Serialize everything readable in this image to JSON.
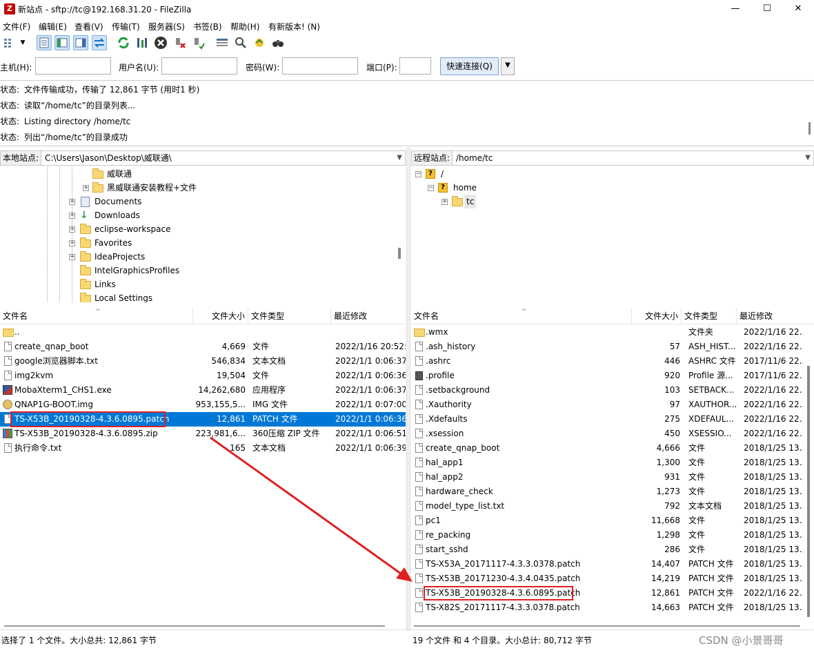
{
  "window": {
    "app_icon": "Z",
    "title": "新站点 - sftp://tc@192.168.31.20 - FileZilla",
    "minimize": "—",
    "maximize": "☐",
    "close": "✕"
  },
  "menu": [
    "文件(F)",
    "编辑(E)",
    "查看(V)",
    "传输(T)",
    "服务器(S)",
    "书签(B)",
    "帮助(H)",
    "有新版本! (N)"
  ],
  "quickconnect": {
    "host_label": "主机(H):",
    "user_label": "用户名(U):",
    "pass_label": "密码(W):",
    "port_label": "端口(P):",
    "host_value": "",
    "user_value": "",
    "pass_value": "",
    "port_value": "",
    "button": "快速连接(Q)"
  },
  "log": [
    {
      "label": "状态:",
      "text": "文件传输成功，传输了 12,861 字节 (用时1 秒)"
    },
    {
      "label": "状态:",
      "text": "读取“/home/tc”的目录列表..."
    },
    {
      "label": "状态:",
      "text": "Listing directory /home/tc"
    },
    {
      "label": "状态:",
      "text": "列出“/home/tc”的目录成功"
    }
  ],
  "local": {
    "site_label": "本地站点:",
    "path": "C:\\Users\\Jason\\Desktop\\威联通\\",
    "tree": [
      "威联通",
      "黑威联通安装教程+文件",
      "Documents",
      "Downloads",
      "eclipse-workspace",
      "Favorites",
      "IdeaProjects",
      "IntelGraphicsProfiles",
      "Links",
      "Local Settings"
    ],
    "columns": [
      "文件名",
      "文件大小",
      "文件类型",
      "最近修改"
    ],
    "files": [
      {
        "name": "..",
        "size": "",
        "type": "",
        "modified": ""
      },
      {
        "name": "create_qnap_boot",
        "size": "4,669",
        "type": "文件",
        "modified": "2022/1/16 20:52:."
      },
      {
        "name": "google浏览器脚本.txt",
        "size": "546,834",
        "type": "文本文档",
        "modified": "2022/1/1 0:06:37"
      },
      {
        "name": "img2kvm",
        "size": "19,504",
        "type": "文件",
        "modified": "2022/1/1 0:06:36"
      },
      {
        "name": "MobaXterm1_CHS1.exe",
        "size": "14,262,680",
        "type": "应用程序",
        "modified": "2022/1/1 0:06:37"
      },
      {
        "name": "QNAP1G-BOOT.img",
        "size": "953,155,5...",
        "type": "IMG 文件",
        "modified": "2022/1/1 0:07:00"
      },
      {
        "name": "TS-X53B_20190328-4.3.6.0895.patch",
        "size": "12,861",
        "type": "PATCH 文件",
        "modified": "2022/1/1 0:06:36"
      },
      {
        "name": "TS-X53B_20190328-4.3.6.0895.zip",
        "size": "223,981,6...",
        "type": "360压缩 ZIP 文件",
        "modified": "2022/1/1 0:06:51"
      },
      {
        "name": "执行命令.txt",
        "size": "165",
        "type": "文本文档",
        "modified": "2022/1/1 0:06:39"
      }
    ],
    "status": "选择了 1 个文件。大小总共: 12,861 字节"
  },
  "remote": {
    "site_label": "远程站点:",
    "path": "/home/tc",
    "tree": [
      "/",
      "home",
      "tc"
    ],
    "columns": [
      "文件名",
      "文件大小",
      "文件类型",
      "最近修改"
    ],
    "files": [
      {
        "name": ".wmx",
        "size": "",
        "type": "文件夹",
        "modified": "2022/1/16 22.."
      },
      {
        "name": ".ash_history",
        "size": "57",
        "type": "ASH_HIST...",
        "modified": "2022/1/16 22.."
      },
      {
        "name": ".ashrc",
        "size": "446",
        "type": "ASHRC 文件",
        "modified": "2017/11/6 22.."
      },
      {
        "name": ".profile",
        "size": "920",
        "type": "Profile 源...",
        "modified": "2017/11/6 22.."
      },
      {
        "name": ".setbackground",
        "size": "103",
        "type": "SETBACK...",
        "modified": "2022/1/16 22.."
      },
      {
        "name": ".Xauthority",
        "size": "97",
        "type": "XAUTHOR...",
        "modified": "2022/1/16 22.."
      },
      {
        "name": ".Xdefaults",
        "size": "275",
        "type": "XDEFAUL...",
        "modified": "2022/1/16 22.."
      },
      {
        "name": ".xsession",
        "size": "450",
        "type": "XSESSIO...",
        "modified": "2022/1/16 22.."
      },
      {
        "name": "create_qnap_boot",
        "size": "4,666",
        "type": "文件",
        "modified": "2018/1/25 13.."
      },
      {
        "name": "hal_app1",
        "size": "1,300",
        "type": "文件",
        "modified": "2018/1/25 13.."
      },
      {
        "name": "hal_app2",
        "size": "931",
        "type": "文件",
        "modified": "2018/1/25 13.."
      },
      {
        "name": "hardware_check",
        "size": "1,273",
        "type": "文件",
        "modified": "2018/1/25 13.."
      },
      {
        "name": "model_type_list.txt",
        "size": "792",
        "type": "文本文档",
        "modified": "2018/1/25 13.."
      },
      {
        "name": "pc1",
        "size": "11,668",
        "type": "文件",
        "modified": "2018/1/25 13.."
      },
      {
        "name": "re_packing",
        "size": "1,298",
        "type": "文件",
        "modified": "2018/1/25 13.."
      },
      {
        "name": "start_sshd",
        "size": "286",
        "type": "文件",
        "modified": "2018/1/25 13.."
      },
      {
        "name": "TS-X53A_20171117-4.3.3.0378.patch",
        "size": "14,407",
        "type": "PATCH 文件",
        "modified": "2018/1/25 13.."
      },
      {
        "name": "TS-X53B_20171230-4.3.4.0435.patch",
        "size": "14,219",
        "type": "PATCH 文件",
        "modified": "2018/1/25 13.."
      },
      {
        "name": "TS-X53B_20190328-4.3.6.0895.patch",
        "size": "12,861",
        "type": "PATCH 文件",
        "modified": "2022/1/16 22.."
      },
      {
        "name": "TS-X82S_20171117-4.3.3.0378.patch",
        "size": "14,663",
        "type": "PATCH 文件",
        "modified": "2018/1/25 13.."
      }
    ],
    "status": "19 个文件 和 4 个目录。大小总计: 80,712 字节"
  },
  "watermark": "CSDN @小景哥哥",
  "colors": {
    "selection": "#0078d7",
    "annotation": "#e02020",
    "folder": "#f8d775"
  }
}
